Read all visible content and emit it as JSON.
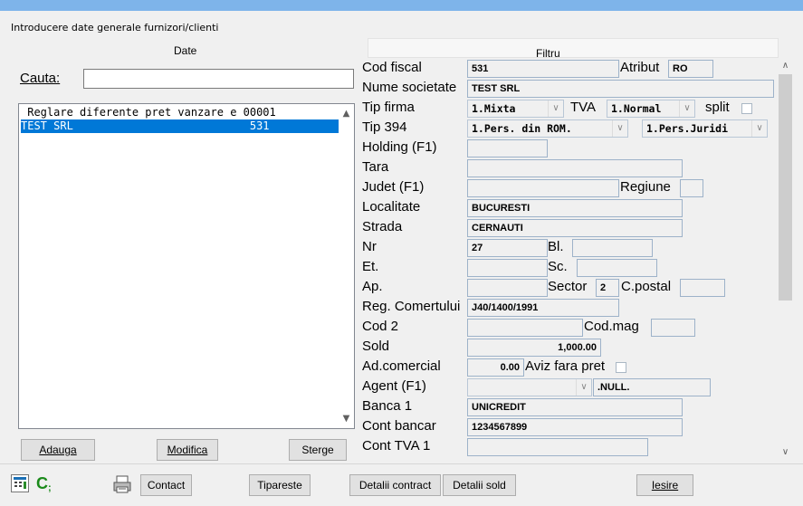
{
  "window": {
    "title": "Introducere date generale furnizori/clienti"
  },
  "tabs": {
    "date": "Date",
    "filtru": "Filtru"
  },
  "search": {
    "label": "Cauta:",
    "value": ""
  },
  "list": {
    "items": [
      {
        "text": " Reglare diferente pret vanzare e 00001"
      },
      {
        "text": "TEST SRL                           531"
      }
    ]
  },
  "list_buttons": {
    "adauga": "Adauga",
    "modifica": "Modifica",
    "sterge": "Sterge"
  },
  "form": {
    "cod_fiscal": {
      "label": "Cod fiscal",
      "value": "531"
    },
    "atribut": {
      "label": "Atribut",
      "value": "RO"
    },
    "nume": {
      "label": "Nume societate",
      "value": "TEST SRL"
    },
    "tip_firma": {
      "label": "Tip firma",
      "value": "1.Mixta"
    },
    "tva": {
      "label": "TVA",
      "value": "1.Normal"
    },
    "split": {
      "label": "split"
    },
    "tip394": {
      "label": "Tip 394",
      "value": "1.Pers. din ROM.",
      "value2": "1.Pers.Juridi"
    },
    "holding": {
      "label": "Holding (F1)",
      "value": ""
    },
    "tara": {
      "label": "Tara",
      "value": ""
    },
    "judet": {
      "label": "Judet (F1)",
      "value": ""
    },
    "regiune": {
      "label": "Regiune",
      "value": ""
    },
    "localitate": {
      "label": "Localitate",
      "value": "BUCURESTI"
    },
    "strada": {
      "label": "Strada",
      "value": "CERNAUTI"
    },
    "nr": {
      "label": "Nr",
      "value": "27"
    },
    "bl": {
      "label": "Bl.",
      "value": ""
    },
    "et": {
      "label": "Et.",
      "value": ""
    },
    "sc": {
      "label": "Sc.",
      "value": ""
    },
    "ap": {
      "label": "Ap.",
      "value": ""
    },
    "sector": {
      "label": "Sector",
      "value": "2"
    },
    "cpostal": {
      "label": "C.postal",
      "value": ""
    },
    "reg_com": {
      "label": "Reg. Comertului",
      "value": "J40/1400/1991"
    },
    "cod2": {
      "label": "Cod 2",
      "value": ""
    },
    "codmag": {
      "label": "Cod.mag",
      "value": ""
    },
    "sold": {
      "label": "Sold",
      "value": "1,000.00"
    },
    "adcom": {
      "label": "Ad.comercial",
      "value": "0.00"
    },
    "aviz": {
      "label": "Aviz fara pret"
    },
    "agent": {
      "label": "Agent (F1)",
      "value": "",
      "value2": ".NULL."
    },
    "banca1": {
      "label": "Banca 1",
      "value": "UNICREDIT"
    },
    "cont_bancar": {
      "label": "Cont bancar",
      "value": "1234567899"
    },
    "cont_tva1": {
      "label": "Cont TVA 1",
      "value": ""
    }
  },
  "bottom": {
    "contact": "Contact",
    "tipareste": "Tipareste",
    "detalii_contract": "Detalii contract",
    "detalii_sold": "Detalii sold",
    "iesire": "Iesire"
  },
  "colors": {
    "selection": "#0078d7",
    "field_border": "#9db2c9",
    "window_bg": "#f0f0f0"
  }
}
